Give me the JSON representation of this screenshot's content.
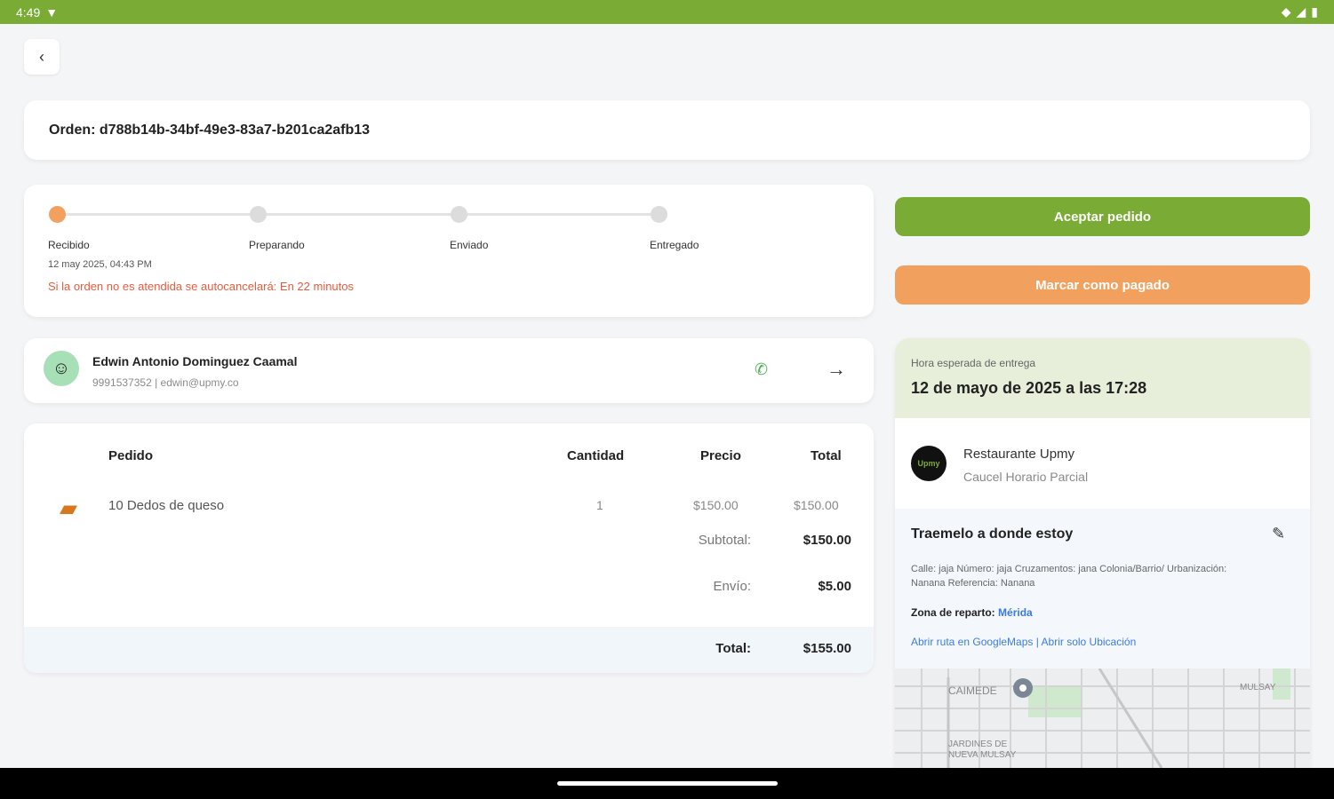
{
  "status_bar": {
    "time": "4:49"
  },
  "order": {
    "title": "Orden: d788b14b-34bf-49e3-83a7-b201ca2afb13"
  },
  "progress": {
    "steps": [
      "Recibido",
      "Preparando",
      "Enviado",
      "Entregado"
    ],
    "active_step": 0,
    "date": "12 may 2025, 04:43 PM",
    "warning": "Si la orden no es atendida se autocancelará: En 22 minutos"
  },
  "customer": {
    "name": "Edwin Antonio Dominguez Caamal",
    "contact": "9991537352 | edwin@upmy.co"
  },
  "items_table": {
    "headers": {
      "item": "Pedido",
      "qty": "Cantidad",
      "price": "Precio",
      "total": "Total"
    },
    "rows": [
      {
        "name": "10 Dedos de queso",
        "qty": "1",
        "price": "$150.00",
        "total": "$150.00"
      }
    ],
    "subtotal_label": "Subtotal:",
    "subtotal": "$150.00",
    "shipping_label": "Envío:",
    "shipping": "$5.00",
    "total_label": "Total:",
    "total": "$155.00"
  },
  "actions": {
    "accept": "Aceptar pedido",
    "mark_paid": "Marcar como pagado"
  },
  "delivery": {
    "eta_label": "Hora esperada de entrega",
    "eta_value": "12 de mayo de 2025 a las 17:28",
    "restaurant_logo": "Upmy",
    "restaurant_name": "Restaurante Upmy",
    "restaurant_sub": "Caucel Horario Parcial",
    "address_title": "Traemelo a donde estoy",
    "address_text": "Calle: jaja Número: jaja Cruzamentos: jana Colonia/Barrio/ Urbanización: Nanana Referencia: Nanana",
    "zone_label": "Zona de reparto:",
    "zone_value": "Mérida",
    "map_links": "Abrir ruta en GoogleMaps | Abrir solo Ubicación",
    "map_labels": [
      "CAIMEDE",
      "JARDINES DE NUEVA MULSAY",
      "MULSAY"
    ]
  },
  "colors": {
    "brand_green": "#7aab35",
    "accent_orange": "#f2a05e",
    "warning_red": "#ea5a3c",
    "link_blue": "#3b7be0"
  }
}
